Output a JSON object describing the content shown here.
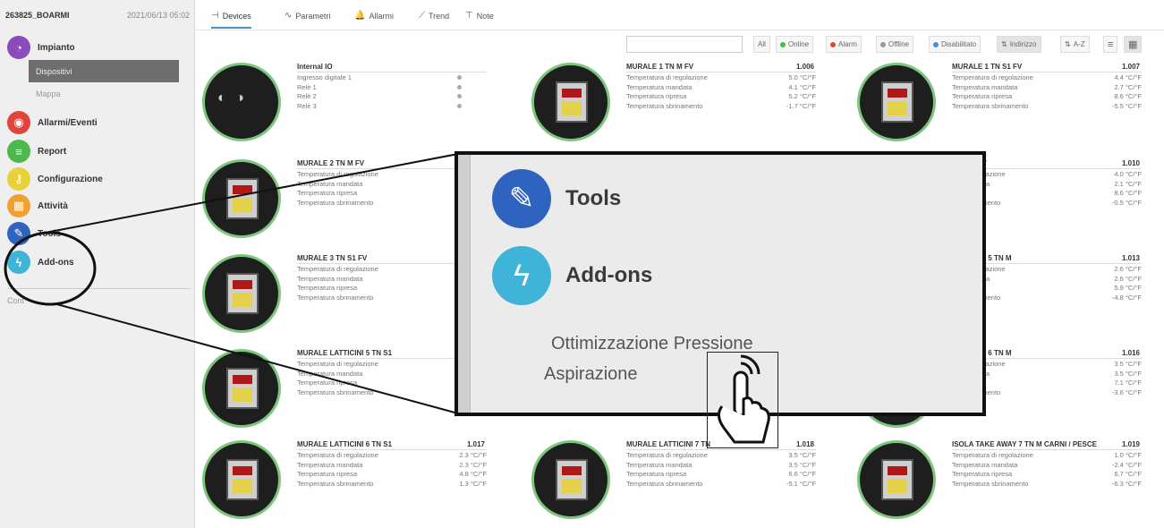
{
  "sidebar": {
    "site": "263825_BOARMI",
    "datetime": "2021/06/13 05:02",
    "items": [
      {
        "label": "Impianto",
        "color": "#8b4bbd",
        "icon": "gauge-icon"
      },
      {
        "label": "Allarmi/Eventi",
        "color": "#e0443c",
        "icon": "alarm-icon"
      },
      {
        "label": "Report",
        "color": "#4bb94b",
        "icon": "report-icon"
      },
      {
        "label": "Configurazione",
        "color": "#e8d23a",
        "icon": "key-icon"
      },
      {
        "label": "Attività",
        "color": "#f0a030",
        "icon": "calendar-icon"
      },
      {
        "label": "Tools",
        "color": "#2e64c0",
        "icon": "wrench-icon"
      },
      {
        "label": "Add-ons",
        "color": "#3fb4d8",
        "icon": "lightning-icon"
      }
    ],
    "sub_dispositivi": "Dispositivi",
    "sub_mappa": "Mappa",
    "footer": "Cont"
  },
  "tabs": [
    {
      "label": "Devices",
      "icon": "⊣"
    },
    {
      "label": "Parametri",
      "icon": "∿"
    },
    {
      "label": "Allarmi",
      "icon": "🔔"
    },
    {
      "label": "Trend",
      "icon": "⟋"
    },
    {
      "label": "Note",
      "icon": "⊤"
    }
  ],
  "filters": {
    "search_placeholder": "",
    "all": "All",
    "online": "Online",
    "alarm": "Alarm",
    "offline": "Offline",
    "disabled": "Disabilitato",
    "sort1": "Indirizzo",
    "sort2": "A-Z",
    "colors": {
      "online": "#4bb94b",
      "alarm": "#e0443c",
      "offline": "#999999",
      "disabled": "#4a8fd4"
    }
  },
  "devices": [
    {
      "name": "Internal IO",
      "num": "",
      "rows": [
        {
          "label": "Ingresso digitale 1",
          "value": ""
        },
        {
          "label": "Relè 1",
          "value": ""
        },
        {
          "label": "Relè 2",
          "value": ""
        },
        {
          "label": "Relè 3",
          "value": ""
        }
      ]
    },
    {
      "name": "MURALE 1 TN M FV",
      "num": "1.006",
      "rows": [
        {
          "label": "Temperatura di regolazione",
          "value": "5.0 °C/°F"
        },
        {
          "label": "Temperatura mandata",
          "value": "4.1 °C/°F"
        },
        {
          "label": "Temperatura ripresa",
          "value": "5.2 °C/°F"
        },
        {
          "label": "Temperatura sbrinamento",
          "value": "-1.7 °C/°F"
        }
      ]
    },
    {
      "name": "MURALE 1 TN S1 FV",
      "num": "1.007",
      "rows": [
        {
          "label": "Temperatura di regolazione",
          "value": "4.4 °C/°F"
        },
        {
          "label": "Temperatura mandata",
          "value": "2.7 °C/°F"
        },
        {
          "label": "Temperatura ripresa",
          "value": "8.6 °C/°F"
        },
        {
          "label": "Temperatura sbrinamento",
          "value": "-5.5 °C/°F"
        }
      ]
    },
    {
      "name": "MURALE 2 TN M FV",
      "num": "",
      "rows": [
        {
          "label": "Temperatura di regolazione",
          "value": ""
        },
        {
          "label": "Temperatura mandata",
          "value": ""
        },
        {
          "label": "Temperatura ripresa",
          "value": ""
        },
        {
          "label": "Temperatura sbrinamento",
          "value": ""
        }
      ]
    },
    {
      "name": "3 TN M FV",
      "num": "1.010",
      "rows": [
        {
          "label": "ura di regolazione",
          "value": "4.0 °C/°F"
        },
        {
          "label": "ura mandata",
          "value": "2.1 °C/°F"
        },
        {
          "label": "ura ripresa",
          "value": "8.6 °C/°F"
        },
        {
          "label": "ura sbrinamento",
          "value": "-0.5 °C/°F"
        }
      ]
    },
    {
      "name": "MURALE 3 TN S1 FV",
      "num": "",
      "rows": [
        {
          "label": "Temperatura di regolazione",
          "value": ""
        },
        {
          "label": "Temperatura mandata",
          "value": ""
        },
        {
          "label": "Temperatura ripresa",
          "value": ""
        },
        {
          "label": "Temperatura sbrinamento",
          "value": ""
        }
      ]
    },
    {
      "name": "LATTICINI 5 TN M",
      "num": "1.013",
      "rows": [
        {
          "label": "ura di regolazione",
          "value": "2.6 °C/°F"
        },
        {
          "label": "ura mandata",
          "value": "2.6 °C/°F"
        },
        {
          "label": "ura ripresa",
          "value": "5.9 °C/°F"
        },
        {
          "label": "ura sbrinamento",
          "value": "-4.8 °C/°F"
        }
      ]
    },
    {
      "name": "MURALE LATTICINI 5 TN S1",
      "num": "",
      "rows": [
        {
          "label": "Temperatura di regolazione",
          "value": ""
        },
        {
          "label": "Temperatura mandata",
          "value": ""
        },
        {
          "label": "Temperatura ripresa",
          "value": ""
        },
        {
          "label": "Temperatura sbrinamento",
          "value": ""
        }
      ]
    },
    {
      "name": "LATTICINI 6 TN M",
      "num": "1.016",
      "rows": [
        {
          "label": "ura di regolazione",
          "value": "3.5 °C/°F"
        },
        {
          "label": "ura mandata",
          "value": "3.5 °C/°F"
        },
        {
          "label": "ura ripresa",
          "value": "7.1 °C/°F"
        },
        {
          "label": "ura sbrinamento",
          "value": "-3.6 °C/°F"
        }
      ]
    },
    {
      "name": "MURALE LATTICINI 6 TN S1",
      "num": "1.017",
      "rows": [
        {
          "label": "Temperatura di regolazione",
          "value": "2.3 °C/°F"
        },
        {
          "label": "Temperatura mandata",
          "value": "2.3 °C/°F"
        },
        {
          "label": "Temperatura ripresa",
          "value": "4.8 °C/°F"
        },
        {
          "label": "Temperatura sbrinamento",
          "value": "1.3 °C/°F"
        }
      ]
    },
    {
      "name": "MURALE LATTICINI 7 TN",
      "num": "1.018",
      "rows": [
        {
          "label": "Temperatura di regolazione",
          "value": "3.5 °C/°F"
        },
        {
          "label": "Temperatura mandata",
          "value": "3.5 °C/°F"
        },
        {
          "label": "Temperatura ripresa",
          "value": "6.6 °C/°F"
        },
        {
          "label": "Temperatura sbrinamento",
          "value": "-5.1 °C/°F"
        }
      ]
    },
    {
      "name": "ISOLA TAKE AWAY 7 TN M CARNI / PESCE",
      "num": "1.019",
      "rows": [
        {
          "label": "Temperatura di regolazione",
          "value": "1.0 °C/°F"
        },
        {
          "label": "Temperatura mandata",
          "value": "-2.4 °C/°F"
        },
        {
          "label": "Temperatura ripresa",
          "value": "6.7 °C/°F"
        },
        {
          "label": "Temperatura sbrinamento",
          "value": "-6.3 °C/°F"
        }
      ]
    }
  ],
  "callout": {
    "tools_label": "Tools",
    "addons_label": "Add-ons",
    "addon_line1": "Ottimizzazione Pressione",
    "addon_line2": "Aspirazione",
    "tools_color": "#2e64c0",
    "addons_color": "#3fb4d8"
  }
}
